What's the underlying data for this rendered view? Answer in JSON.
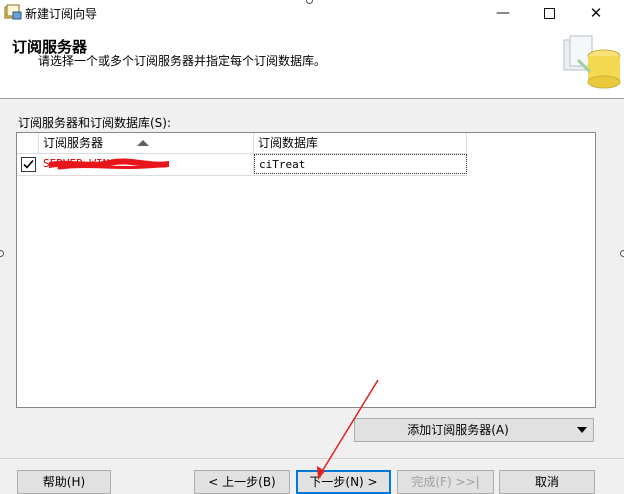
{
  "window": {
    "title": "新建订阅向导",
    "controls": {
      "minimize": "—",
      "close": "✕"
    }
  },
  "header": {
    "title": "订阅服务器",
    "subtitle": "请选择一个或多个订阅服务器并指定每个订阅数据库。"
  },
  "grid": {
    "label": "订阅服务器和订阅数据库(S):",
    "columns": [
      "订阅服务器",
      "订阅数据库"
    ],
    "rows": [
      {
        "checked": true,
        "server": "SERVER-WIN",
        "database": "ciTreat"
      }
    ]
  },
  "buttons": {
    "add_subscriber": "添加订阅服务器(A)",
    "help": "帮助(H)",
    "back": "< 上一步(B)",
    "next": "下一步(N) >",
    "finish": "完成(F) >>|",
    "cancel": "取消"
  },
  "colors": {
    "annotation_arrow": "#e02020",
    "redaction": "#e8161b",
    "focus_border": "#0078d7"
  }
}
